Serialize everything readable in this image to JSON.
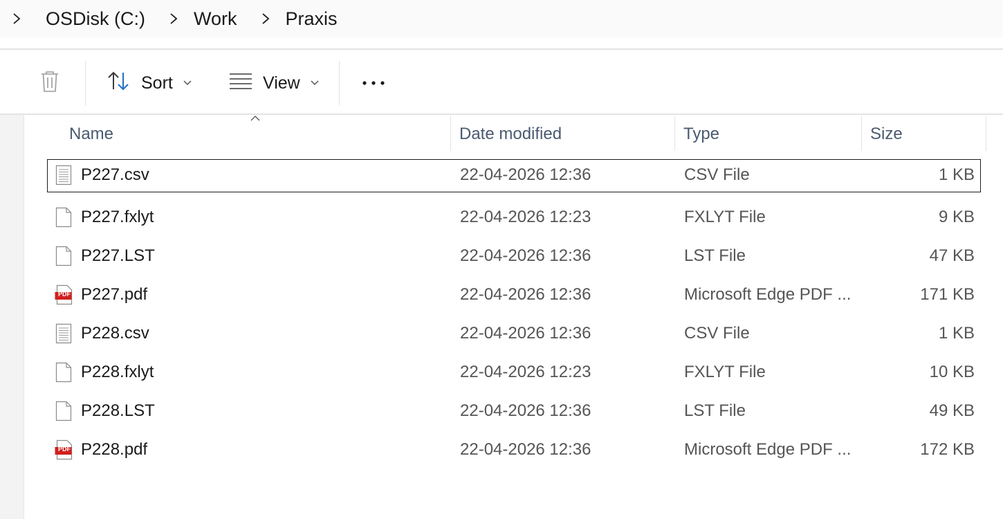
{
  "breadcrumb": {
    "items": [
      "OSDisk (C:)",
      "Work",
      "Praxis"
    ]
  },
  "toolbar": {
    "sort_label": "Sort",
    "view_label": "View"
  },
  "columns": {
    "name": "Name",
    "date": "Date modified",
    "type": "Type",
    "size": "Size"
  },
  "files": [
    {
      "name": "P227.csv",
      "date": "22-04-2026 12:36",
      "type": "CSV File",
      "size": "1 KB",
      "icon": "text-file-icon"
    },
    {
      "name": "P227.fxlyt",
      "date": "22-04-2026 12:23",
      "type": "FXLYT File",
      "size": "9 KB",
      "icon": "blank-file-icon"
    },
    {
      "name": "P227.LST",
      "date": "22-04-2026 12:36",
      "type": "LST File",
      "size": "47 KB",
      "icon": "blank-file-icon"
    },
    {
      "name": "P227.pdf",
      "date": "22-04-2026 12:36",
      "type": "Microsoft Edge PDF ...",
      "size": "171 KB",
      "icon": "pdf-file-icon"
    },
    {
      "name": "P228.csv",
      "date": "22-04-2026 12:36",
      "type": "CSV File",
      "size": "1 KB",
      "icon": "text-file-icon"
    },
    {
      "name": "P228.fxlyt",
      "date": "22-04-2026 12:23",
      "type": "FXLYT File",
      "size": "10 KB",
      "icon": "blank-file-icon"
    },
    {
      "name": "P228.LST",
      "date": "22-04-2026 12:36",
      "type": "LST File",
      "size": "49 KB",
      "icon": "blank-file-icon"
    },
    {
      "name": "P228.pdf",
      "date": "22-04-2026 12:36",
      "type": "Microsoft Edge PDF ...",
      "size": "172 KB",
      "icon": "pdf-file-icon"
    }
  ],
  "pdf_badge": "PDF",
  "colors": {
    "pdf_red": "#d0201f",
    "sort_arrow_blue": "#1f6fc5",
    "header_text": "#4a5a70"
  }
}
